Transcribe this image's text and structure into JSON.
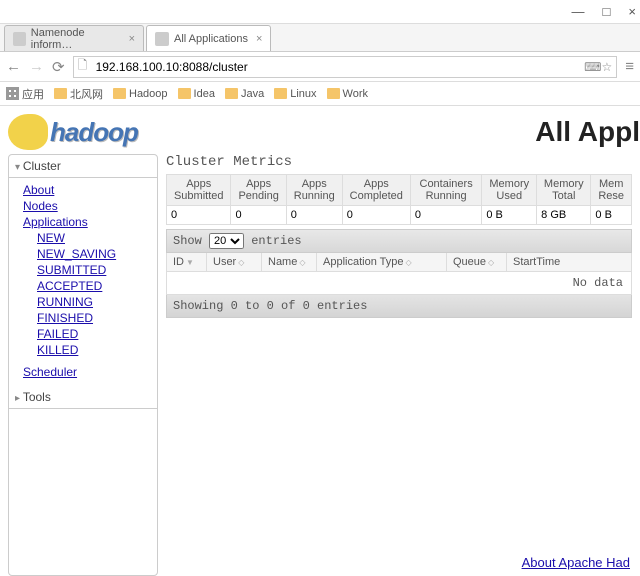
{
  "window": {
    "minimize": "—",
    "maximize": "□",
    "close": "×"
  },
  "tabs": [
    {
      "label": "Namenode inform…",
      "active": false
    },
    {
      "label": "All Applications",
      "active": true
    }
  ],
  "nav": {
    "url": "192.168.100.10:8088/cluster"
  },
  "bookmarks": {
    "apps": "应用",
    "items": [
      "北风网",
      "Hadoop",
      "Idea",
      "Java",
      "Linux",
      "Work"
    ]
  },
  "logo_text": "hadoop",
  "page_title": "All Appl",
  "sidebar": {
    "cluster_label": "Cluster",
    "links": {
      "about": "About",
      "nodes": "Nodes",
      "applications": "Applications"
    },
    "states": [
      "NEW",
      "NEW_SAVING",
      "SUBMITTED",
      "ACCEPTED",
      "RUNNING",
      "FINISHED",
      "FAILED",
      "KILLED"
    ],
    "scheduler": "Scheduler",
    "tools_label": "Tools"
  },
  "metrics": {
    "title": "Cluster Metrics",
    "headers": [
      "Apps Submitted",
      "Apps Pending",
      "Apps Running",
      "Apps Completed",
      "Containers Running",
      "Memory Used",
      "Memory Total",
      "Mem Rese"
    ],
    "values": [
      "0",
      "0",
      "0",
      "0",
      "0",
      "0 B",
      "8 GB",
      "0 B"
    ]
  },
  "table": {
    "show_label": "Show",
    "show_value": "20",
    "entries_label": "entries",
    "cols": {
      "id": "ID",
      "user": "User",
      "name": "Name",
      "apptype": "Application Type",
      "queue": "Queue",
      "start": "StartTime"
    },
    "no_data": "No data",
    "showing": "Showing 0 to 0 of 0 entries"
  },
  "footer": "About Apache Had"
}
